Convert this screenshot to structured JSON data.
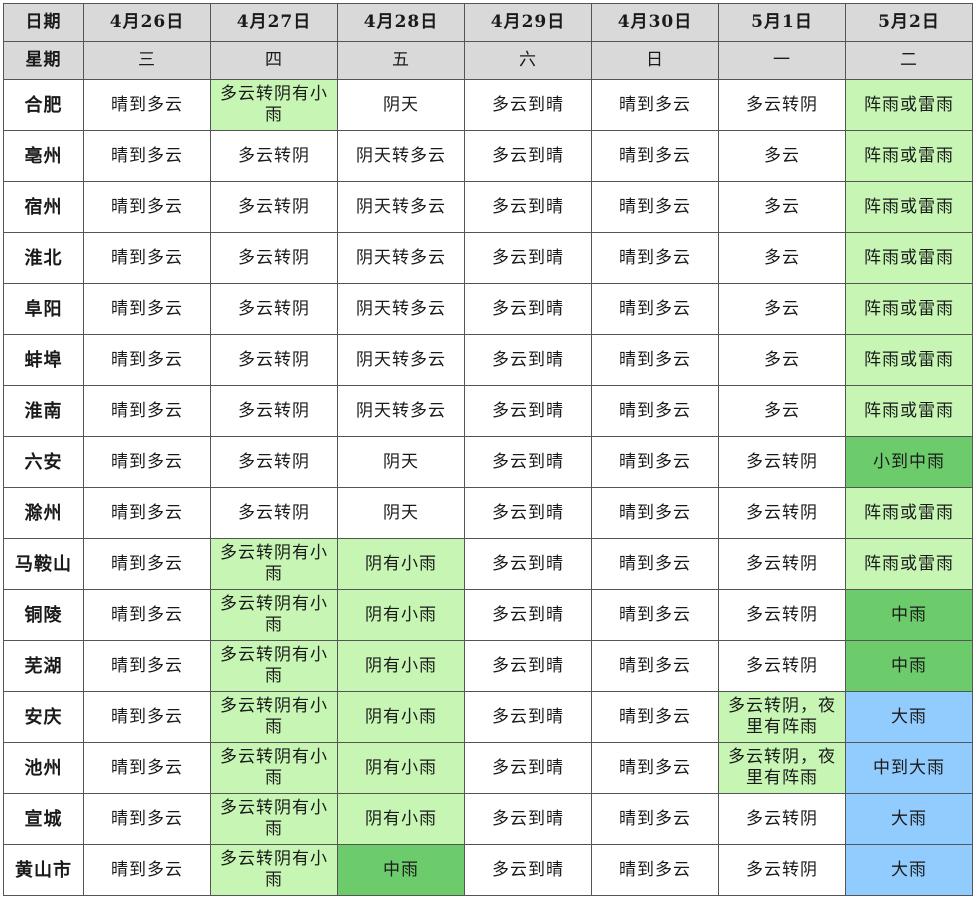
{
  "table": {
    "row_label_date": "日期",
    "row_label_week": "星期",
    "dates": [
      "4月26日",
      "4月27日",
      "4月28日",
      "4月29日",
      "4月30日",
      "5月1日",
      "5月2日"
    ],
    "weekdays": [
      "三",
      "四",
      "五",
      "六",
      "日",
      "一",
      "二"
    ],
    "colors": {
      "none": "#ffffff",
      "light_rain": "#c6f5b4",
      "moderate_rain": "#6ccc6c",
      "heavy_rain": "#92ccff",
      "header": "#d9d9d9"
    },
    "rows": [
      {
        "city": "合肥",
        "cells": [
          {
            "text": "晴到多云",
            "level": "none"
          },
          {
            "text": "多云转阴有小雨",
            "level": "light"
          },
          {
            "text": "阴天",
            "level": "none"
          },
          {
            "text": "多云到晴",
            "level": "none"
          },
          {
            "text": "晴到多云",
            "level": "none"
          },
          {
            "text": "多云转阴",
            "level": "none"
          },
          {
            "text": "阵雨或雷雨",
            "level": "light"
          }
        ]
      },
      {
        "city": "亳州",
        "cells": [
          {
            "text": "晴到多云",
            "level": "none"
          },
          {
            "text": "多云转阴",
            "level": "none"
          },
          {
            "text": "阴天转多云",
            "level": "none"
          },
          {
            "text": "多云到晴",
            "level": "none"
          },
          {
            "text": "晴到多云",
            "level": "none"
          },
          {
            "text": "多云",
            "level": "none"
          },
          {
            "text": "阵雨或雷雨",
            "level": "light"
          }
        ]
      },
      {
        "city": "宿州",
        "cells": [
          {
            "text": "晴到多云",
            "level": "none"
          },
          {
            "text": "多云转阴",
            "level": "none"
          },
          {
            "text": "阴天转多云",
            "level": "none"
          },
          {
            "text": "多云到晴",
            "level": "none"
          },
          {
            "text": "晴到多云",
            "level": "none"
          },
          {
            "text": "多云",
            "level": "none"
          },
          {
            "text": "阵雨或雷雨",
            "level": "light"
          }
        ]
      },
      {
        "city": "淮北",
        "cells": [
          {
            "text": "晴到多云",
            "level": "none"
          },
          {
            "text": "多云转阴",
            "level": "none"
          },
          {
            "text": "阴天转多云",
            "level": "none"
          },
          {
            "text": "多云到晴",
            "level": "none"
          },
          {
            "text": "晴到多云",
            "level": "none"
          },
          {
            "text": "多云",
            "level": "none"
          },
          {
            "text": "阵雨或雷雨",
            "level": "light"
          }
        ]
      },
      {
        "city": "阜阳",
        "cells": [
          {
            "text": "晴到多云",
            "level": "none"
          },
          {
            "text": "多云转阴",
            "level": "none"
          },
          {
            "text": "阴天转多云",
            "level": "none"
          },
          {
            "text": "多云到晴",
            "level": "none"
          },
          {
            "text": "晴到多云",
            "level": "none"
          },
          {
            "text": "多云",
            "level": "none"
          },
          {
            "text": "阵雨或雷雨",
            "level": "light"
          }
        ]
      },
      {
        "city": "蚌埠",
        "cells": [
          {
            "text": "晴到多云",
            "level": "none"
          },
          {
            "text": "多云转阴",
            "level": "none"
          },
          {
            "text": "阴天转多云",
            "level": "none"
          },
          {
            "text": "多云到晴",
            "level": "none"
          },
          {
            "text": "晴到多云",
            "level": "none"
          },
          {
            "text": "多云",
            "level": "none"
          },
          {
            "text": "阵雨或雷雨",
            "level": "light"
          }
        ]
      },
      {
        "city": "淮南",
        "cells": [
          {
            "text": "晴到多云",
            "level": "none"
          },
          {
            "text": "多云转阴",
            "level": "none"
          },
          {
            "text": "阴天转多云",
            "level": "none"
          },
          {
            "text": "多云到晴",
            "level": "none"
          },
          {
            "text": "晴到多云",
            "level": "none"
          },
          {
            "text": "多云",
            "level": "none"
          },
          {
            "text": "阵雨或雷雨",
            "level": "light"
          }
        ]
      },
      {
        "city": "六安",
        "cells": [
          {
            "text": "晴到多云",
            "level": "none"
          },
          {
            "text": "多云转阴",
            "level": "none"
          },
          {
            "text": "阴天",
            "level": "none"
          },
          {
            "text": "多云到晴",
            "level": "none"
          },
          {
            "text": "晴到多云",
            "level": "none"
          },
          {
            "text": "多云转阴",
            "level": "none"
          },
          {
            "text": "小到中雨",
            "level": "mid"
          }
        ]
      },
      {
        "city": "滁州",
        "cells": [
          {
            "text": "晴到多云",
            "level": "none"
          },
          {
            "text": "多云转阴",
            "level": "none"
          },
          {
            "text": "阴天",
            "level": "none"
          },
          {
            "text": "多云到晴",
            "level": "none"
          },
          {
            "text": "晴到多云",
            "level": "none"
          },
          {
            "text": "多云转阴",
            "level": "none"
          },
          {
            "text": "阵雨或雷雨",
            "level": "light"
          }
        ]
      },
      {
        "city": "马鞍山",
        "cells": [
          {
            "text": "晴到多云",
            "level": "none"
          },
          {
            "text": "多云转阴有小雨",
            "level": "light"
          },
          {
            "text": "阴有小雨",
            "level": "light"
          },
          {
            "text": "多云到晴",
            "level": "none"
          },
          {
            "text": "晴到多云",
            "level": "none"
          },
          {
            "text": "多云转阴",
            "level": "none"
          },
          {
            "text": "阵雨或雷雨",
            "level": "light"
          }
        ]
      },
      {
        "city": "铜陵",
        "cells": [
          {
            "text": "晴到多云",
            "level": "none"
          },
          {
            "text": "多云转阴有小雨",
            "level": "light"
          },
          {
            "text": "阴有小雨",
            "level": "light"
          },
          {
            "text": "多云到晴",
            "level": "none"
          },
          {
            "text": "晴到多云",
            "level": "none"
          },
          {
            "text": "多云转阴",
            "level": "none"
          },
          {
            "text": "中雨",
            "level": "mid"
          }
        ]
      },
      {
        "city": "芜湖",
        "cells": [
          {
            "text": "晴到多云",
            "level": "none"
          },
          {
            "text": "多云转阴有小雨",
            "level": "light"
          },
          {
            "text": "阴有小雨",
            "level": "light"
          },
          {
            "text": "多云到晴",
            "level": "none"
          },
          {
            "text": "晴到多云",
            "level": "none"
          },
          {
            "text": "多云转阴",
            "level": "none"
          },
          {
            "text": "中雨",
            "level": "mid"
          }
        ]
      },
      {
        "city": "安庆",
        "cells": [
          {
            "text": "晴到多云",
            "level": "none"
          },
          {
            "text": "多云转阴有小雨",
            "level": "light"
          },
          {
            "text": "阴有小雨",
            "level": "light"
          },
          {
            "text": "多云到晴",
            "level": "none"
          },
          {
            "text": "晴到多云",
            "level": "none"
          },
          {
            "text": "多云转阴，夜里有阵雨",
            "level": "light"
          },
          {
            "text": "大雨",
            "level": "heavy"
          }
        ]
      },
      {
        "city": "池州",
        "cells": [
          {
            "text": "晴到多云",
            "level": "none"
          },
          {
            "text": "多云转阴有小雨",
            "level": "light"
          },
          {
            "text": "阴有小雨",
            "level": "light"
          },
          {
            "text": "多云到晴",
            "level": "none"
          },
          {
            "text": "晴到多云",
            "level": "none"
          },
          {
            "text": "多云转阴，夜里有阵雨",
            "level": "light"
          },
          {
            "text": "中到大雨",
            "level": "heavy"
          }
        ]
      },
      {
        "city": "宣城",
        "cells": [
          {
            "text": "晴到多云",
            "level": "none"
          },
          {
            "text": "多云转阴有小雨",
            "level": "light"
          },
          {
            "text": "阴有小雨",
            "level": "light"
          },
          {
            "text": "多云到晴",
            "level": "none"
          },
          {
            "text": "晴到多云",
            "level": "none"
          },
          {
            "text": "多云转阴",
            "level": "none"
          },
          {
            "text": "大雨",
            "level": "heavy"
          }
        ]
      },
      {
        "city": "黄山市",
        "cells": [
          {
            "text": "晴到多云",
            "level": "none"
          },
          {
            "text": "多云转阴有小雨",
            "level": "light"
          },
          {
            "text": "中雨",
            "level": "mid"
          },
          {
            "text": "多云到晴",
            "level": "none"
          },
          {
            "text": "晴到多云",
            "level": "none"
          },
          {
            "text": "多云转阴",
            "level": "none"
          },
          {
            "text": "大雨",
            "level": "heavy"
          }
        ]
      }
    ]
  }
}
